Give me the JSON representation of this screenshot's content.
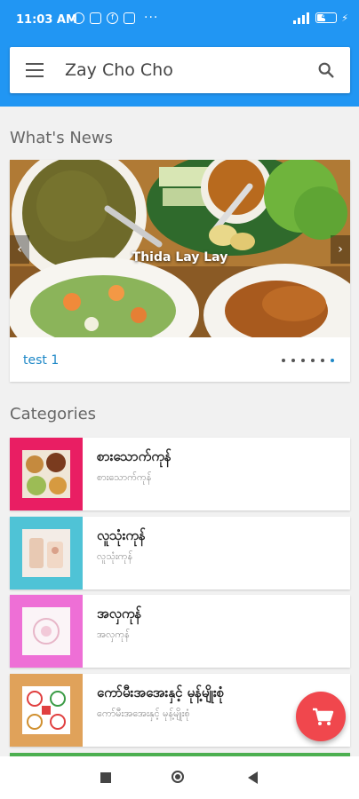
{
  "status_bar": {
    "time": "11:03 AM",
    "icons": [
      "alarm-icon",
      "message-icon",
      "facebook-icon",
      "app-icon"
    ],
    "more": "···",
    "battery": "48"
  },
  "search_bar": {
    "title": "Zay Cho Cho"
  },
  "sections": {
    "news_title": "What's News",
    "categories_title": "Categories"
  },
  "slider": {
    "caption": "Thida Lay Lay",
    "label": "test 1",
    "dots_count": 6,
    "prev_icon": "chevron-left-icon",
    "next_icon": "chevron-right-icon"
  },
  "categories": [
    {
      "title": "စားသောက်ကုန်",
      "subtitle": "စားသောက်ကုန်",
      "color": "#e91e63"
    },
    {
      "title": "လူသုံးကုန်",
      "subtitle": "လူသုံးကုန်",
      "color": "#4fc3d6"
    },
    {
      "title": "အလှကုန်",
      "subtitle": "အလှကုန်",
      "color": "#ee6fd6"
    },
    {
      "title": "ကော်မီးအအေးနှင့် မုန့်မျိုးစုံ",
      "subtitle": "ကော်မီးအအေးနှင့် မုန့်မျိုးစုံ",
      "color": "#e0a25a"
    }
  ],
  "fab_icon": "cart-icon",
  "colors": {
    "primary": "#2196f3",
    "fab": "#f0474d",
    "link": "#1e88c7"
  }
}
